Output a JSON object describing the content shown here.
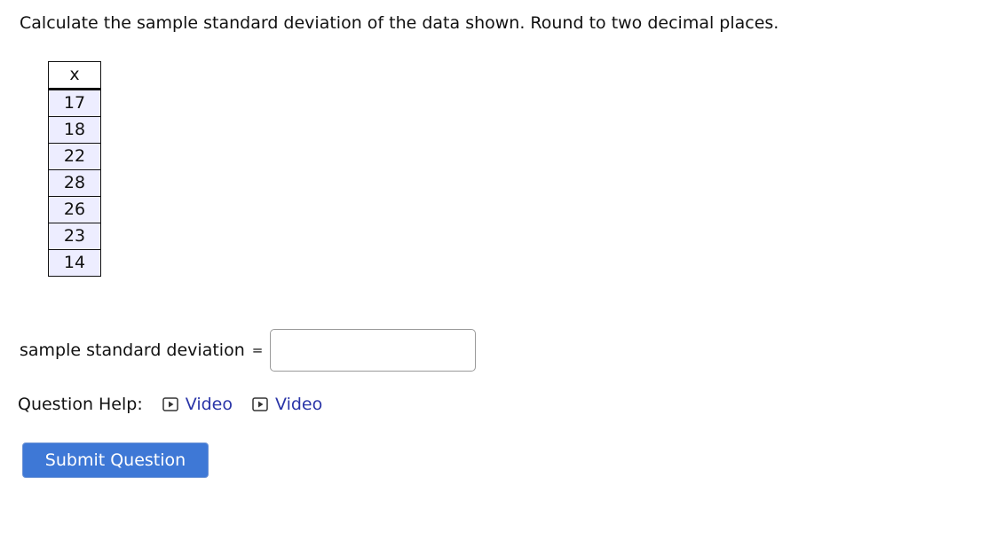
{
  "question": {
    "text": "Calculate the sample standard deviation of the data shown. Round to two decimal places."
  },
  "data_table": {
    "header": "x",
    "values": [
      "17",
      "18",
      "22",
      "28",
      "26",
      "23",
      "14"
    ]
  },
  "answer": {
    "label": "sample standard deviation",
    "equals": "=",
    "value": "",
    "placeholder": ""
  },
  "help": {
    "label": "Question Help:",
    "links": [
      {
        "label": "Video",
        "icon": "play-icon"
      },
      {
        "label": "Video",
        "icon": "play-icon"
      }
    ],
    "link_color": "#2a35a8"
  },
  "submit": {
    "label": "Submit Question",
    "color": "#3e78d6"
  }
}
